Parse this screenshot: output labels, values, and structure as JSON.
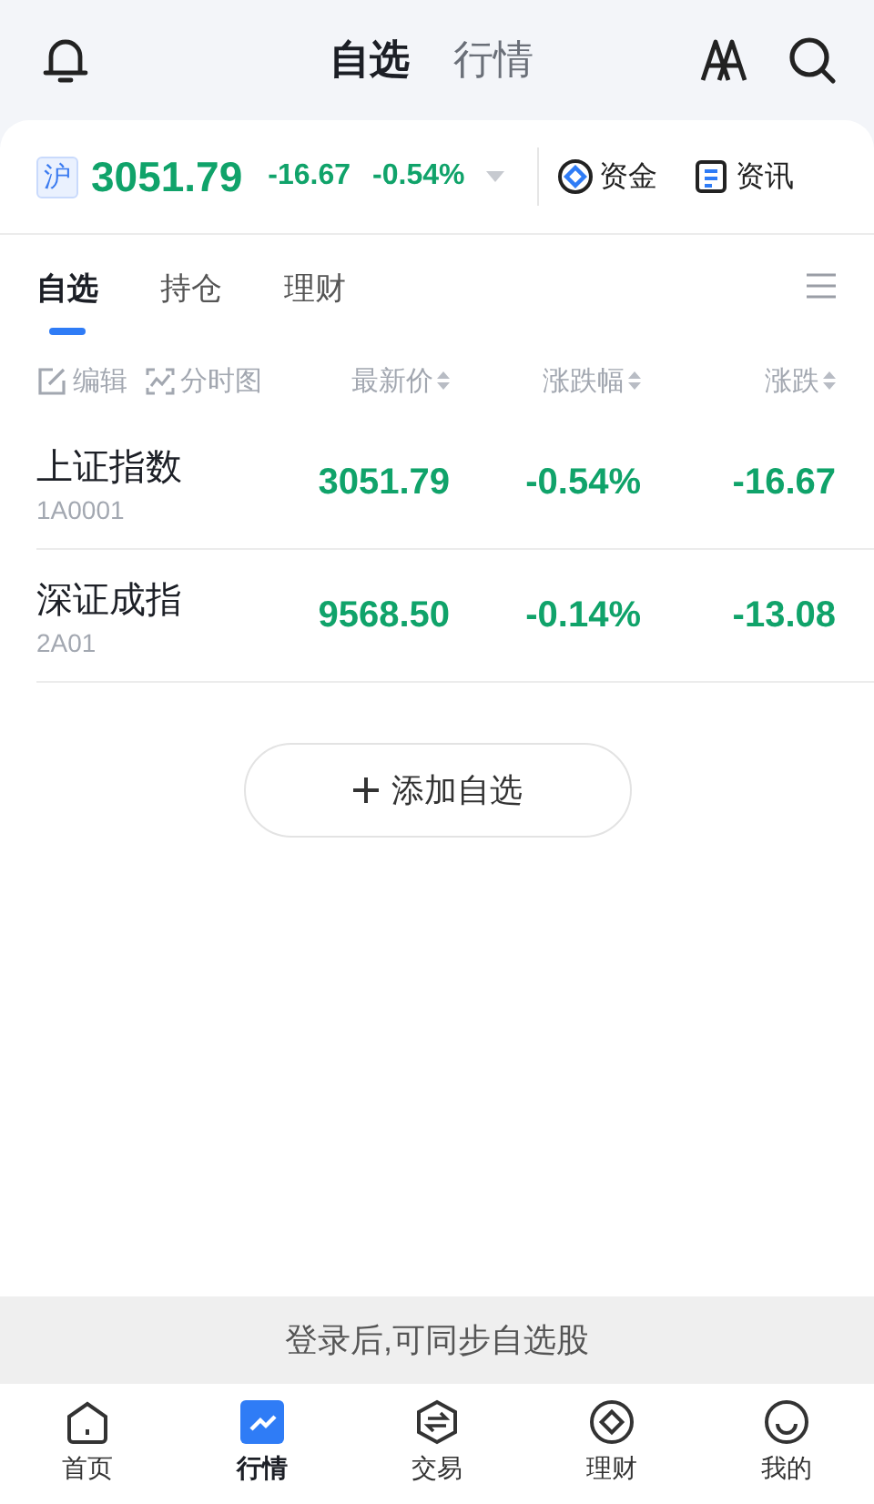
{
  "header": {
    "tabs": [
      {
        "label": "自选",
        "selected": true
      },
      {
        "label": "行情",
        "selected": false
      }
    ]
  },
  "index_bar": {
    "market": "沪",
    "value": "3051.79",
    "change": "-16.67",
    "percent": "-0.54%",
    "color": "#10a36a",
    "links": [
      "资金",
      "资讯"
    ]
  },
  "sub_tabs": [
    {
      "label": "自选",
      "selected": true
    },
    {
      "label": "持仓",
      "selected": false
    },
    {
      "label": "理财",
      "selected": false
    }
  ],
  "list_header": {
    "actions": [
      "编辑",
      "分时图"
    ],
    "columns": [
      "最新价",
      "涨跌幅",
      "涨跌"
    ]
  },
  "rows": [
    {
      "name": "上证指数",
      "code": "1A0001",
      "price": "3051.79",
      "percent": "-0.54%",
      "change": "-16.67",
      "color": "#10a36a"
    },
    {
      "name": "深证成指",
      "code": "2A01",
      "price": "9568.50",
      "percent": "-0.14%",
      "change": "-13.08",
      "color": "#10a36a"
    }
  ],
  "add_button": "添加自选",
  "login_banner": "登录后,可同步自选股",
  "bottom_nav": [
    {
      "label": "首页",
      "selected": false
    },
    {
      "label": "行情",
      "selected": true
    },
    {
      "label": "交易",
      "selected": false
    },
    {
      "label": "理财",
      "selected": false
    },
    {
      "label": "我的",
      "selected": false
    }
  ]
}
